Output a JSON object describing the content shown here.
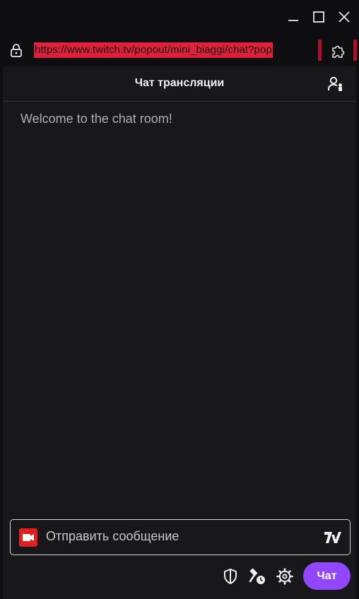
{
  "window": {
    "controls": {
      "minimize_icon": "minimize-icon",
      "maximize_icon": "maximize-icon",
      "close_icon": "close-icon"
    }
  },
  "address_bar": {
    "url": "https://www.twitch.tv/popout/mini_biaggi/chat?pop",
    "url_highlight_color": "#e0203a",
    "lock_icon": "lock-icon",
    "extension_icon": "puzzle-icon"
  },
  "chat": {
    "header": {
      "title": "Чат трансляции",
      "users_icon": "community-icon"
    },
    "welcome_message": "Welcome to the chat room!",
    "input": {
      "placeholder": "Отправить сообщение",
      "left_icon": "video-camera-icon",
      "right_icon": "7tv-emote-icon"
    },
    "toolbar": {
      "shield_icon": "shield-icon",
      "mod_icon": "mod-tools-icon",
      "settings_icon": "gear-icon",
      "send_label": "Чат"
    }
  },
  "colors": {
    "accent": "#9147ff",
    "background": "#0e0e10",
    "panel": "#18181b",
    "camera_red": "#e02020"
  }
}
